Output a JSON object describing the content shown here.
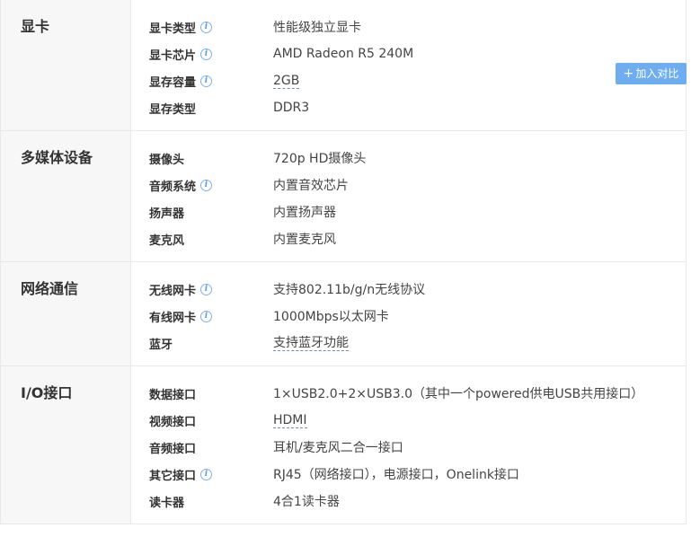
{
  "compare_button": {
    "plus": "+",
    "label": "加入对比"
  },
  "sections": [
    {
      "title": "显卡",
      "rows": [
        {
          "key": "显卡类型",
          "val": "性能级独立显卡"
        },
        {
          "key": "显卡芯片",
          "val": "AMD Radeon R5 240M"
        },
        {
          "key": "显存容量",
          "val": "2GB"
        },
        {
          "key": "显存类型",
          "val": "DDR3"
        }
      ]
    },
    {
      "title": "多媒体设备",
      "rows": [
        {
          "key": "摄像头",
          "val": "720p HD摄像头"
        },
        {
          "key": "音频系统",
          "val": "内置音效芯片"
        },
        {
          "key": "扬声器",
          "val": "内置扬声器"
        },
        {
          "key": "麦克风",
          "val": "内置麦克风"
        }
      ]
    },
    {
      "title": "网络通信",
      "rows": [
        {
          "key": "无线网卡",
          "val": "支持802.11b/g/n无线协议"
        },
        {
          "key": "有线网卡",
          "val": "1000Mbps以太网卡"
        },
        {
          "key": "蓝牙",
          "val": "支持蓝牙功能"
        }
      ]
    },
    {
      "title": "I/O接口",
      "rows": [
        {
          "key": "数据接口",
          "val": "1×USB2.0+2×USB3.0（其中一个powered供电USB共用接口）"
        },
        {
          "key": "视频接口",
          "val": "HDMI"
        },
        {
          "key": "音频接口",
          "val": "耳机/麦克风二合一接口"
        },
        {
          "key": "其它接口",
          "val": "RJ45（网络接口），电源接口，Onelink接口"
        },
        {
          "key": "读卡器",
          "val": "4合1读卡器"
        }
      ]
    }
  ],
  "info_icon": "i"
}
